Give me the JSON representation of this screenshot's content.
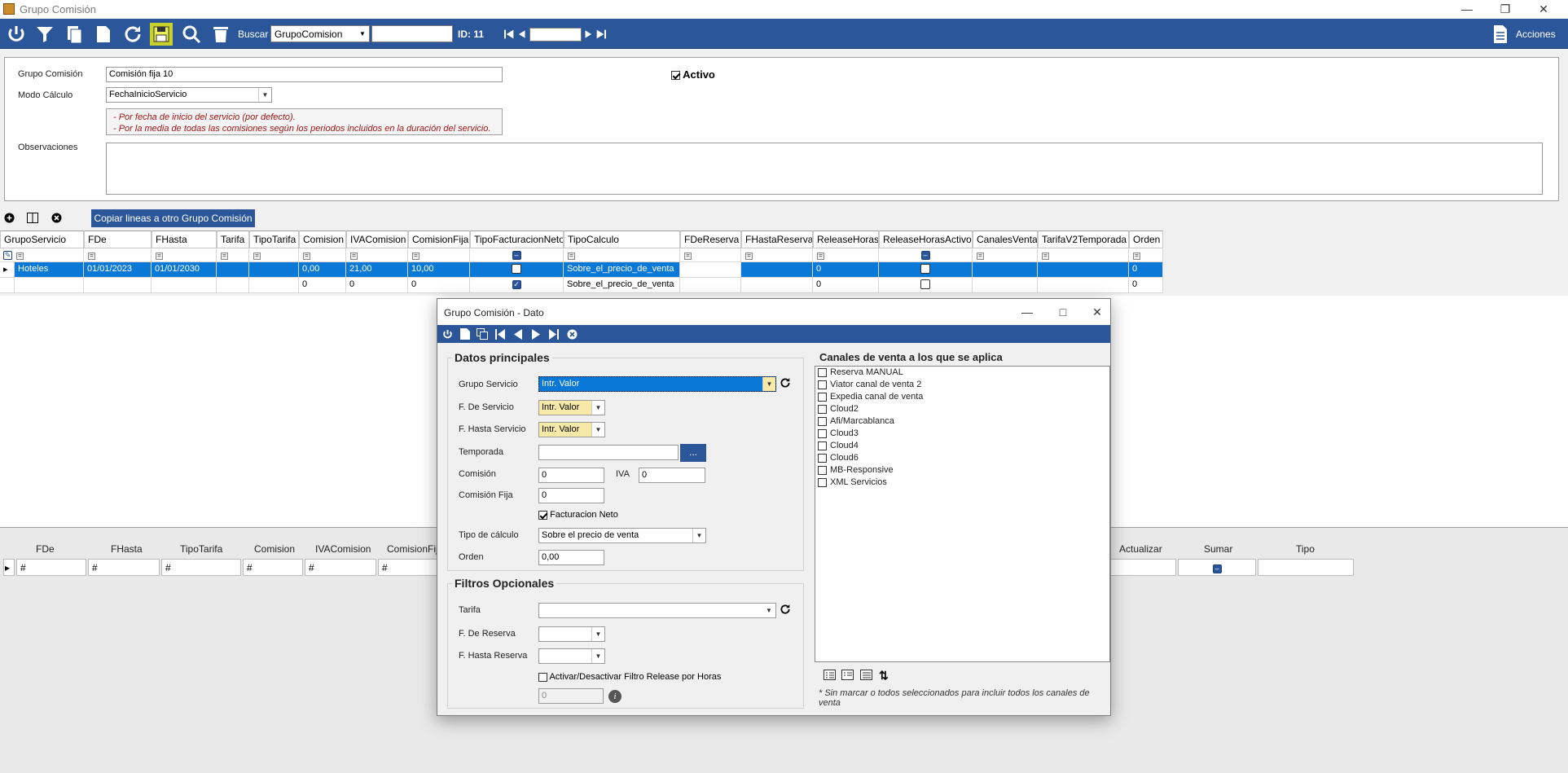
{
  "window": {
    "title": "Grupo Comisión"
  },
  "toolbar": {
    "search_label": "Buscar",
    "search_field": "GrupoComision",
    "search_value": "",
    "id_label": "ID: 11",
    "nav_value": "",
    "actions_label": "Acciones"
  },
  "header": {
    "grupo_label": "Grupo Comisión",
    "grupo_value": "Comisión fija 10",
    "modo_label": "Modo Cálculo",
    "modo_value": "FechaInicioServicio",
    "help_line1": "- Por fecha de inicio del servicio (por defecto).",
    "help_line2": "- Por la media de todas las comisiones según los periodos incluidos en la duración del servicio.",
    "obs_label": "Observaciones",
    "obs_value": "",
    "activo_label": "Activo",
    "activo_checked": true
  },
  "grid_toolbar": {
    "copy_label": "Copiar lineas a otro Grupo Comisión"
  },
  "grid": {
    "columns": [
      "GrupoServicio",
      "FDe",
      "FHasta",
      "Tarifa",
      "TipoTarifa",
      "Comision",
      "IVAComision",
      "ComisionFija",
      "TipoFacturacionNeto",
      "TipoCalculo",
      "FDeReserva",
      "FHastaReserva",
      "ReleaseHoras",
      "ReleaseHorasActivo",
      "CanalesVenta",
      "TarifaV2Temporada",
      "Orden"
    ],
    "rows": [
      {
        "grupo": "Hoteles",
        "fde": "01/01/2023",
        "fhasta": "01/01/2030",
        "tarifa": "",
        "tipotarifa": "",
        "comision": "0,00",
        "iva": "21,00",
        "fija": "10,00",
        "neto": false,
        "tipocalc": "Sobre_el_precio_de_venta",
        "fdereserva": "",
        "fhastareserva": "",
        "release": "0",
        "releaseactivo": false,
        "canales": "",
        "tarifav2": "",
        "orden": "0"
      },
      {
        "grupo": "",
        "fde": "",
        "fhasta": "",
        "tarifa": "",
        "tipotarifa": "",
        "comision": "0",
        "iva": "0",
        "fija": "0",
        "neto": true,
        "tipocalc": "Sobre_el_precio_de_venta",
        "fdereserva": "",
        "fhastareserva": "",
        "release": "0",
        "releaseactivo": false,
        "canales": "",
        "tarifav2": "",
        "orden": "0"
      }
    ]
  },
  "lower_grid": {
    "columns": [
      "FDe",
      "FHasta",
      "TipoTarifa",
      "Comision",
      "IVAComision",
      "ComisionFij",
      "Actualizar",
      "Sumar",
      "Tipo"
    ],
    "filter_placeholder": "#"
  },
  "dialog": {
    "title": "Grupo Comisión - Dato",
    "main_group_title": "Datos principales",
    "grupo_servicio_label": "Grupo Servicio",
    "grupo_servicio_value": "Intr. Valor",
    "f_servicio_label": "F. De Servicio",
    "f_servicio_value": "Intr. Valor",
    "f_hasta_servicio_label": "F. Hasta Servicio",
    "f_hasta_servicio_value": "Intr. Valor",
    "temporada_label": "Temporada",
    "temporada_value": "",
    "temporada_btn": "...",
    "comision_label": "Comisión",
    "comision_value": "0",
    "iva_label": "IVA",
    "iva_value": "0",
    "comision_fija_label": "Comisión Fija",
    "comision_fija_value": "0",
    "facturacion_neto_label": "Facturacion Neto",
    "facturacion_neto_checked": true,
    "tipo_calculo_label": "Tipo de cálculo",
    "tipo_calculo_value": "Sobre el precio de venta",
    "orden_label": "Orden",
    "orden_value": "0,00",
    "filters_group_title": "Filtros Opcionales",
    "tarifa_label": "Tarifa",
    "tarifa_value": "",
    "f_reserva_label": "F. De Reserva",
    "f_hasta_reserva_label": "F. Hasta Reserva",
    "release_label": "Activar/Desactivar Filtro Release por Horas",
    "release_value": "0",
    "channels_title": "Canales de venta a los que se aplica",
    "channels": [
      "Reserva MANUAL",
      "Viator canal de venta 2",
      "Expedia canal de venta",
      "Cloud2",
      "Afi/Marcablanca",
      "Cloud3",
      "Cloud4",
      "Cloud6",
      "MB-Responsive",
      "XML Servicios"
    ],
    "channels_note": "* Sin marcar o todos seleccionados para incluir todos los canales de venta"
  },
  "colors": {
    "accent": "#2b579a",
    "selection": "#0a78d7",
    "highlight": "#f7e9a8",
    "help_text": "#a31515"
  }
}
